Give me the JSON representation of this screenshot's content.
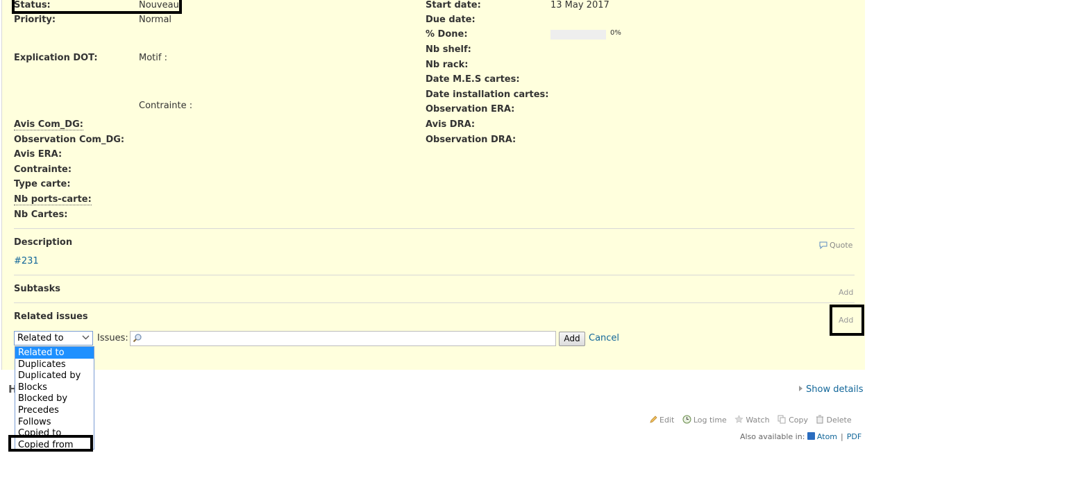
{
  "attributes_left": [
    {
      "label": "Status:",
      "value": "Nouveau"
    },
    {
      "label": "Priority:",
      "value": "Normal"
    },
    {
      "label": "Explication DOT:",
      "value": "Motif :"
    },
    {
      "label": "",
      "value": "Contrainte :"
    },
    {
      "label": "Avis Com_DG:",
      "value": ""
    },
    {
      "label": "Observation Com_DG:",
      "value": ""
    },
    {
      "label": "Avis ERA:",
      "value": ""
    },
    {
      "label": "Contrainte:",
      "value": ""
    },
    {
      "label": "Type carte:",
      "value": ""
    },
    {
      "label": "Nb ports-carte:",
      "value": ""
    },
    {
      "label": "Nb Cartes:",
      "value": ""
    }
  ],
  "attributes_right": [
    {
      "label": "Start date:",
      "value": "13 May 2017"
    },
    {
      "label": "Due date:",
      "value": ""
    },
    {
      "label": "% Done:",
      "value": "0%",
      "progress": 0
    },
    {
      "label": "Nb shelf:",
      "value": ""
    },
    {
      "label": "Nb rack:",
      "value": ""
    },
    {
      "label": "Date M.E.S cartes:",
      "value": ""
    },
    {
      "label": "Date installation cartes:",
      "value": ""
    },
    {
      "label": "Observation ERA:",
      "value": ""
    },
    {
      "label": "Avis DRA:",
      "value": ""
    },
    {
      "label": "Observation DRA:",
      "value": ""
    }
  ],
  "description": {
    "title": "Description",
    "quote_label": "Quote",
    "text": "#231"
  },
  "subtasks": {
    "title": "Subtasks",
    "add_label": "Add"
  },
  "related": {
    "title": "Related issues",
    "add_label": "Add",
    "select_value": "Related to",
    "issues_label": "Issues:",
    "add_button": "Add",
    "cancel_label": "Cancel",
    "options": [
      "Related to",
      "Duplicates",
      "Duplicated by",
      "Blocks",
      "Blocked by",
      "Precedes",
      "Follows",
      "Copied to",
      "Copied from"
    ]
  },
  "history": {
    "title_visible": "H",
    "show_details": "Show details"
  },
  "actions": {
    "edit": "Edit",
    "log_time": "Log time",
    "watch": "Watch",
    "copy": "Copy",
    "delete": "Delete"
  },
  "also_available": {
    "label": "Also available in:",
    "atom": "Atom",
    "pdf": "PDF"
  },
  "colors": {
    "issue_bg": "#ffffdd",
    "link": "#116699",
    "selected_option": "#1e90ff"
  }
}
